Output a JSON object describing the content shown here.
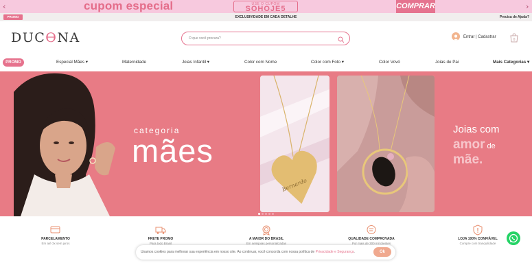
{
  "promo_bar": {
    "left_arrow": "‹",
    "right_arrow": "›",
    "headline": "cupom especial",
    "coupon_prefix": "USE O CUPOM",
    "coupon_code": "SOHOJE5",
    "cta": "COMPRAR",
    "bg_color": "#f7c9de",
    "accent": "#e46d8a"
  },
  "info_bar": {
    "tag": "PROMO",
    "message": "EXCLUSIVIDADE EM CADA DETALHE",
    "help": "Precisa de Ajuda?"
  },
  "header": {
    "logo_prefix": "DUC",
    "logo_mid": "Ɵ",
    "logo_suffix": "NA",
    "search_placeholder": "O que você procura?",
    "account_label": "Entrar | Cadastrar",
    "cart_count": "0"
  },
  "nav": {
    "promo": "PROMO",
    "items": [
      {
        "label": "Especial Mães",
        "chevron": "▾"
      },
      {
        "label": "Maternidade",
        "chevron": ""
      },
      {
        "label": "Joias Infantil",
        "chevron": "▾"
      },
      {
        "label": "Color com Nome",
        "chevron": ""
      },
      {
        "label": "Color com Foto",
        "chevron": "▾"
      },
      {
        "label": "Color Vovó",
        "chevron": ""
      },
      {
        "label": "Joias de Pai",
        "chevron": ""
      },
      {
        "label": "Mais Categorias",
        "chevron": "▾"
      }
    ]
  },
  "hero": {
    "category_small": "categoria",
    "category_big": "mães",
    "right_line1": "Joias com",
    "right_line2": "amor",
    "right_line2b": " de",
    "right_line3": "mãe.",
    "pendant_engraving": "Bernardo",
    "bg_color": "#e87b85"
  },
  "features": [
    {
      "title": "PARCELAMENTO",
      "subtitle": "Em até 3x sem juros",
      "icon": "card-icon"
    },
    {
      "title": "FRETE PROMO",
      "subtitle": "Para todo Brasil",
      "icon": "truck-icon"
    },
    {
      "title": "A MAIOR DO BRASIL",
      "subtitle": "Em semijoias personalizadas",
      "icon": "award-icon"
    },
    {
      "title": "QUALIDADE COMPROVADA",
      "subtitle": "Por mais de 300 mil clientes",
      "icon": "chat-icon"
    },
    {
      "title": "LOJA 100% CONFIÁVEL",
      "subtitle": "Compre com tranquilidade",
      "icon": "shield-icon"
    }
  ],
  "cookie": {
    "text": "Usamos cookies para melhorar sua experiência em nosso site. Ao continuar, você concorda com nossa política de ",
    "link": "Privacidade e Segurança",
    "suffix": ".",
    "ok": "Ok"
  }
}
